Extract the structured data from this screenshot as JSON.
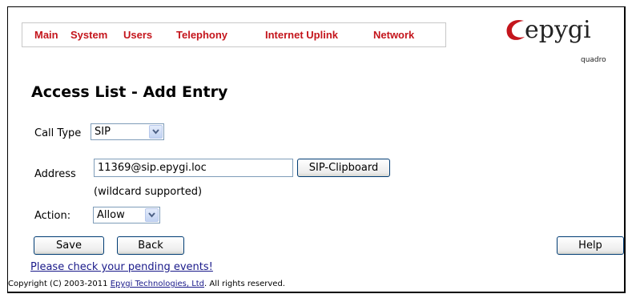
{
  "nav": {
    "items": [
      {
        "label": "Main"
      },
      {
        "label": "System"
      },
      {
        "label": "Users"
      },
      {
        "label": "Telephony"
      },
      {
        "label": "Internet Uplink"
      },
      {
        "label": "Network"
      }
    ]
  },
  "brand": {
    "logo": "epygi",
    "sub": "quadro",
    "accent_color": "#c4151c"
  },
  "page": {
    "title": "Access List - Add Entry"
  },
  "form": {
    "call_type": {
      "label": "Call Type",
      "value": "SIP"
    },
    "address": {
      "label": "Address",
      "value": "11369@sip.epygi.loc",
      "hint": "(wildcard supported)",
      "clipboard_button": "SIP-Clipboard"
    },
    "action": {
      "label": "Action:",
      "value": "Allow"
    }
  },
  "buttons": {
    "save": "Save",
    "back": "Back",
    "help": "Help"
  },
  "footer": {
    "pending_link": "Please check your pending events!",
    "copyright_prefix": "Copyright (C) 2003-2011 ",
    "company_link": "Epygi Technologies, Ltd",
    "copyright_suffix": ". All rights reserved."
  },
  "icons": {
    "dropdown": "chevron-down-icon"
  }
}
